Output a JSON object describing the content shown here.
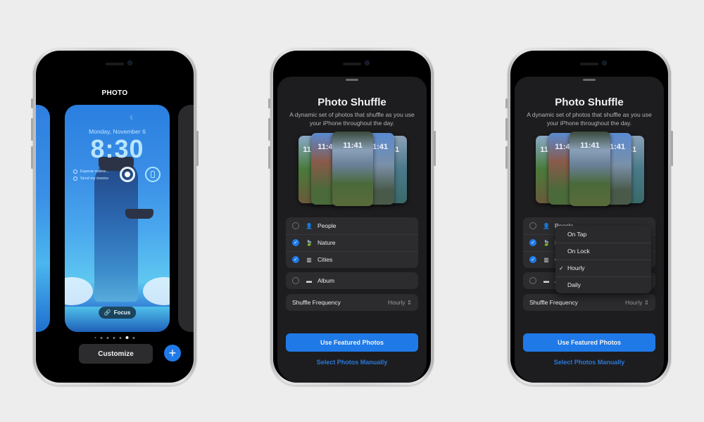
{
  "phone1": {
    "header_label": "PHOTO",
    "lock_screen": {
      "moon_icon": "☾",
      "date": "Monday, November 6",
      "time": "8:30",
      "reminders": [
        "Esperar retene...",
        "Send my invoice"
      ],
      "focus_label": "Focus"
    },
    "page_dots": {
      "count": 7,
      "active_index": 5
    },
    "customize_label": "Customize",
    "add_button_label": "+"
  },
  "photo_shuffle": {
    "title": "Photo Shuffle",
    "description": "A dynamic set of photos that shuffle as you use your iPhone throughout the day.",
    "preview_times": [
      "11:4",
      "11:4",
      "11:41",
      "1:41",
      "41"
    ],
    "categories": [
      {
        "label": "People",
        "icon": "person-icon",
        "glyph": "👤",
        "checked": false
      },
      {
        "label": "Nature",
        "icon": "leaf-icon",
        "glyph": "🍃",
        "checked": true
      },
      {
        "label": "Cities",
        "icon": "building-icon",
        "glyph": "▥",
        "checked": true
      }
    ],
    "album": {
      "label": "Album",
      "icon": "album-icon",
      "glyph": "▬",
      "checked": false
    },
    "shuffle_frequency": {
      "label": "Shuffle Frequency",
      "value": "Hourly",
      "chevron": "⌃⌄"
    },
    "primary_button": "Use Featured Photos",
    "secondary_link": "Select Photos Manually"
  },
  "frequency_menu": {
    "options": [
      "On Tap",
      "On Lock",
      "Hourly",
      "Daily"
    ],
    "selected": "Hourly",
    "check_glyph": "✓"
  },
  "colors": {
    "accent": "#1f7ae8",
    "sheet_bg": "#1d1d1f",
    "row_bg": "#2c2c2e",
    "page_bg": "#ededed"
  }
}
